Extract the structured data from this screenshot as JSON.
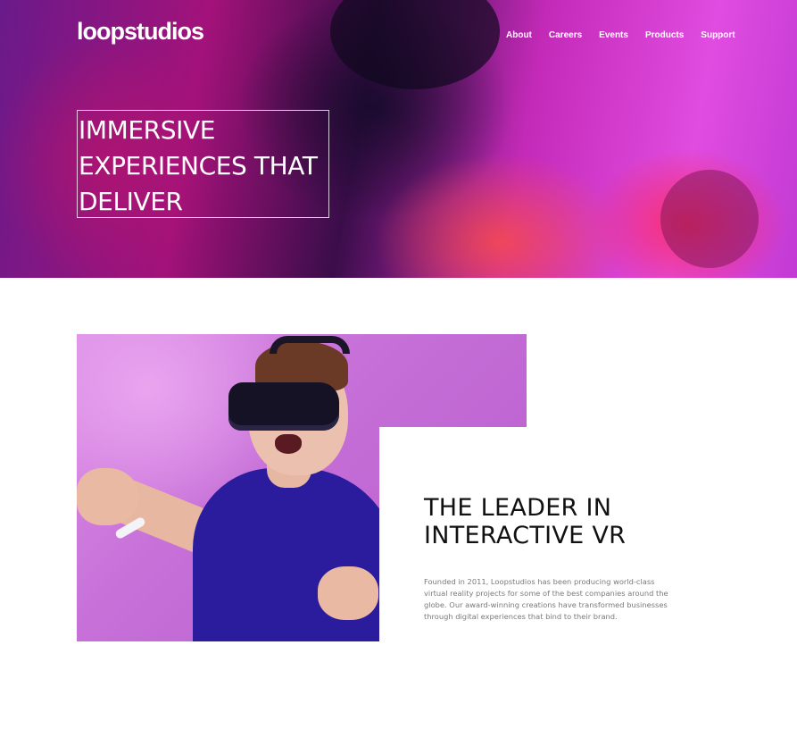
{
  "header": {
    "logo_text": "loopstudios",
    "nav": [
      {
        "label": "About"
      },
      {
        "label": "Careers"
      },
      {
        "label": "Events"
      },
      {
        "label": "Products"
      },
      {
        "label": "Support"
      }
    ],
    "headline": "IMMERSIVE EXPERIENCES THAT DELIVER"
  },
  "about": {
    "title_line1": "THE LEADER IN",
    "title_line2": "INTERACTIVE VR",
    "body": "Founded in 2011, Loopstudios has been producing world-class virtual reality projects for some of the best companies around the globe. Our award-winning creations have transformed businesses through digital experiences that bind to their brand."
  },
  "colors": {
    "hero_magenta": "#c42ab8",
    "hero_purple": "#6a1a8a",
    "text_dark": "#111111",
    "text_gray": "#7a7a7a"
  }
}
